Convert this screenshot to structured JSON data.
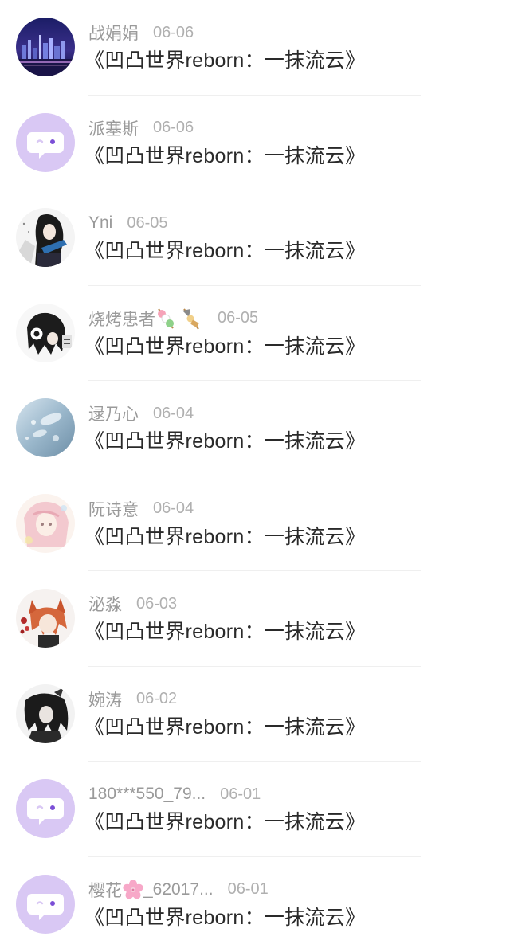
{
  "items": [
    {
      "username": "战娟娟",
      "date": "06-06",
      "title": "《凹凸世界reborn：一抹流云》",
      "avatar": "city-skyline-avatar"
    },
    {
      "username": "派塞斯",
      "date": "06-06",
      "title": "《凹凸世界reborn：一抹流云》",
      "avatar": "default-chat-avatar"
    },
    {
      "username": "Yni",
      "date": "06-05",
      "title": "《凹凸世界reborn：一抹流云》",
      "avatar": "anime-girl-avatar"
    },
    {
      "username": "烧烤患者",
      "date": "06-05",
      "title": "《凹凸世界reborn：一抹流云》",
      "avatar": "anime-boy-avatar",
      "emojis": [
        "dango-emoji",
        "oden-emoji"
      ]
    },
    {
      "username": "逯乃心",
      "date": "06-04",
      "title": "《凹凸世界reborn：一抹流云》",
      "avatar": "water-drops-avatar"
    },
    {
      "username": "阮诗意",
      "date": "06-04",
      "title": "《凹凸世界reborn：一抹流云》",
      "avatar": "pastel-anime-avatar"
    },
    {
      "username": "泌淼",
      "date": "06-03",
      "title": "《凹凸世界reborn：一抹流云》",
      "avatar": "foxgirl-avatar"
    },
    {
      "username": "婉涛",
      "date": "06-02",
      "title": "《凹凸世界reborn：一抹流云》",
      "avatar": "dark-anime-avatar"
    },
    {
      "username": "180***550_79...",
      "date": "06-01",
      "title": "《凹凸世界reborn：一抹流云》",
      "avatar": "default-chat-avatar"
    },
    {
      "username": "樱花",
      "username_suffix": "_62017...",
      "date": "06-01",
      "title": "《凹凸世界reborn：一抹流云》",
      "avatar": "default-chat-avatar",
      "emojis": [
        "cherry-blossom-emoji"
      ]
    }
  ],
  "colors": {
    "default_avatar_bg": "#d9c8f4",
    "username": "#9a9a9a",
    "date": "#b0b0b0",
    "title": "#2a2a2a",
    "divider": "#efefef"
  }
}
